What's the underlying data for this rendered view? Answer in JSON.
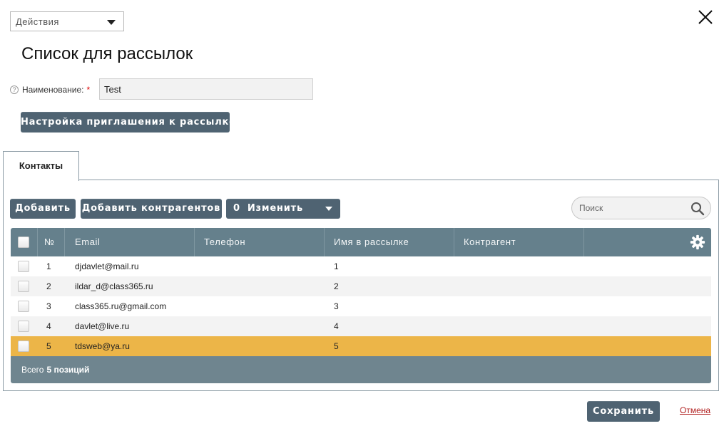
{
  "actions": {
    "label": "Действия"
  },
  "page": {
    "title": "Список для рассылок"
  },
  "form": {
    "help": "?",
    "name_label": "Наименование:",
    "required_mark": "*",
    "name_value": "Test",
    "invite_button": "Настройка приглашения к рассылке"
  },
  "tabs": [
    {
      "label": "Контакты"
    }
  ],
  "toolbar": {
    "add": "Добавить",
    "add_counterparties": "Добавить контрагентов",
    "change_count": "0",
    "change": "Изменить",
    "search_placeholder": "Поиск"
  },
  "table": {
    "columns": [
      "№",
      "Email",
      "Телефон",
      "Имя в рассылке",
      "Контрагент"
    ],
    "rows": [
      {
        "num": "1",
        "email": "djdavlet@mail.ru",
        "phone": "",
        "name": "1",
        "contragent": ""
      },
      {
        "num": "2",
        "email": "ildar_d@class365.ru",
        "phone": "",
        "name": "2",
        "contragent": ""
      },
      {
        "num": "3",
        "email": "class365.ru@gmail.com",
        "phone": "",
        "name": "3",
        "contragent": ""
      },
      {
        "num": "4",
        "email": "davlet@live.ru",
        "phone": "",
        "name": "4",
        "contragent": ""
      },
      {
        "num": "5",
        "email": "tdsweb@ya.ru",
        "phone": "",
        "name": "5",
        "contragent": ""
      }
    ],
    "selected_row": 4,
    "footer_prefix": "Всего",
    "footer_count": "5 позиций"
  },
  "footer": {
    "save": "Сохранить",
    "cancel": "Отмена"
  },
  "colors": {
    "button": "#4f6372",
    "header": "#65808c",
    "footer": "#6f858f",
    "selected_row": "#ecb548",
    "cancel": "#b22222"
  }
}
